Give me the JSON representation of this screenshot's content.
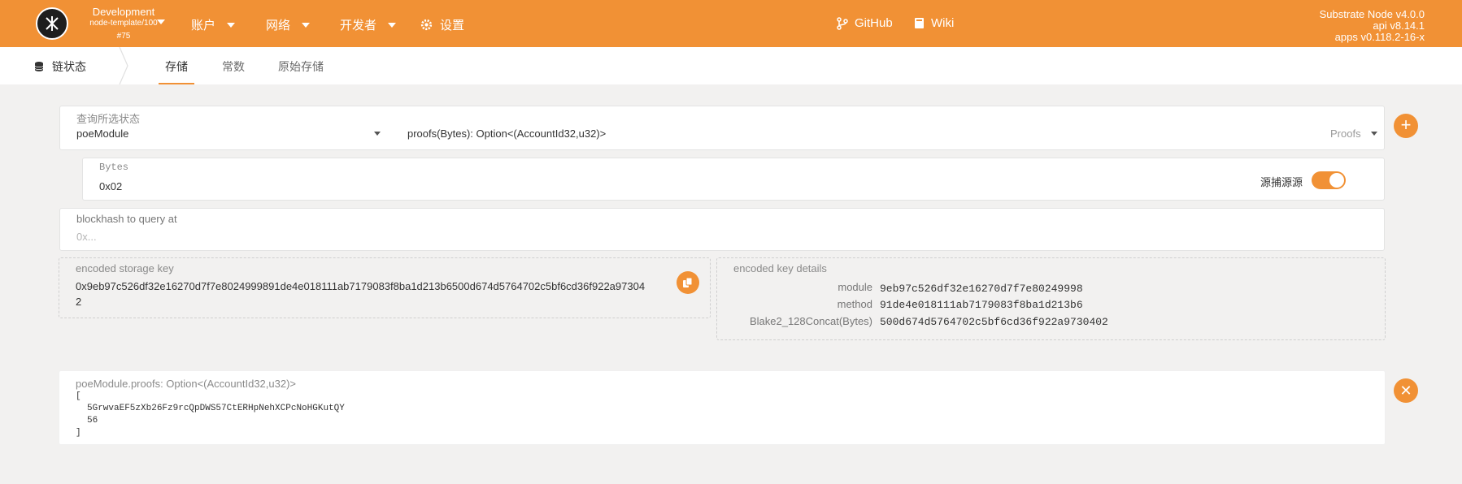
{
  "header": {
    "chain_name": "Development",
    "chain_spec": "node-template/100",
    "block": "#75",
    "menu": [
      {
        "label": "账户",
        "icon": "dropdown-caret"
      },
      {
        "label": "网络",
        "icon": "dropdown-caret"
      },
      {
        "label": "开发者",
        "icon": "dropdown-caret"
      },
      {
        "label": "设置",
        "icon": "gear-icon"
      }
    ],
    "links": [
      {
        "label": "GitHub",
        "icon": "code-branch-icon"
      },
      {
        "label": "Wiki",
        "icon": "book-icon"
      }
    ],
    "node_name": "Substrate Node v4.0.0",
    "api_version": "api v8.14.1",
    "apps_version": "apps v0.118.2-16-x"
  },
  "subnav": {
    "section_label": "链状态",
    "tabs": [
      {
        "label": "存储",
        "active": true
      },
      {
        "label": "常数",
        "active": false
      },
      {
        "label": "原始存储",
        "active": false
      }
    ]
  },
  "query": {
    "label": "查询所选状态",
    "module": "poeModule",
    "method": "proofs(Bytes): Option<(AccountId32,u32)>",
    "method_doc": "Proofs"
  },
  "bytes_param": {
    "label": "Bytes",
    "value": "0x02",
    "toggle_label": "源捕源源"
  },
  "blockhash": {
    "label": "blockhash to query at",
    "placeholder": "0x..."
  },
  "encoded": {
    "label": "encoded storage key",
    "line1": "0x9eb97c526df32e16270d7f7e8024999891de4e018111ab7179083f8ba1d213b6500d674d5764702c5bf6cd36f922a97304",
    "line2": "2"
  },
  "details": {
    "label": "encoded key details",
    "rows": [
      {
        "key": "module",
        "value": "9eb97c526df32e16270d7f7e80249998"
      },
      {
        "key": "method",
        "value": "91de4e018111ab7179083f8ba1d213b6"
      },
      {
        "key": "Blake2_128Concat(Bytes)",
        "value": "500d674d5764702c5bf6cd36f922a9730402"
      }
    ]
  },
  "result": {
    "label": "poeModule.proofs: Option<(AccountId32,u32)>",
    "open": "[",
    "account": "5GrwvaEF5zXb26Fz9rcQpDWS57CtERHpNehXCPcNoHGKutQY",
    "number": "56",
    "close": "]"
  },
  "colors": {
    "accent": "#f19135",
    "background": "#f2f1f0"
  }
}
